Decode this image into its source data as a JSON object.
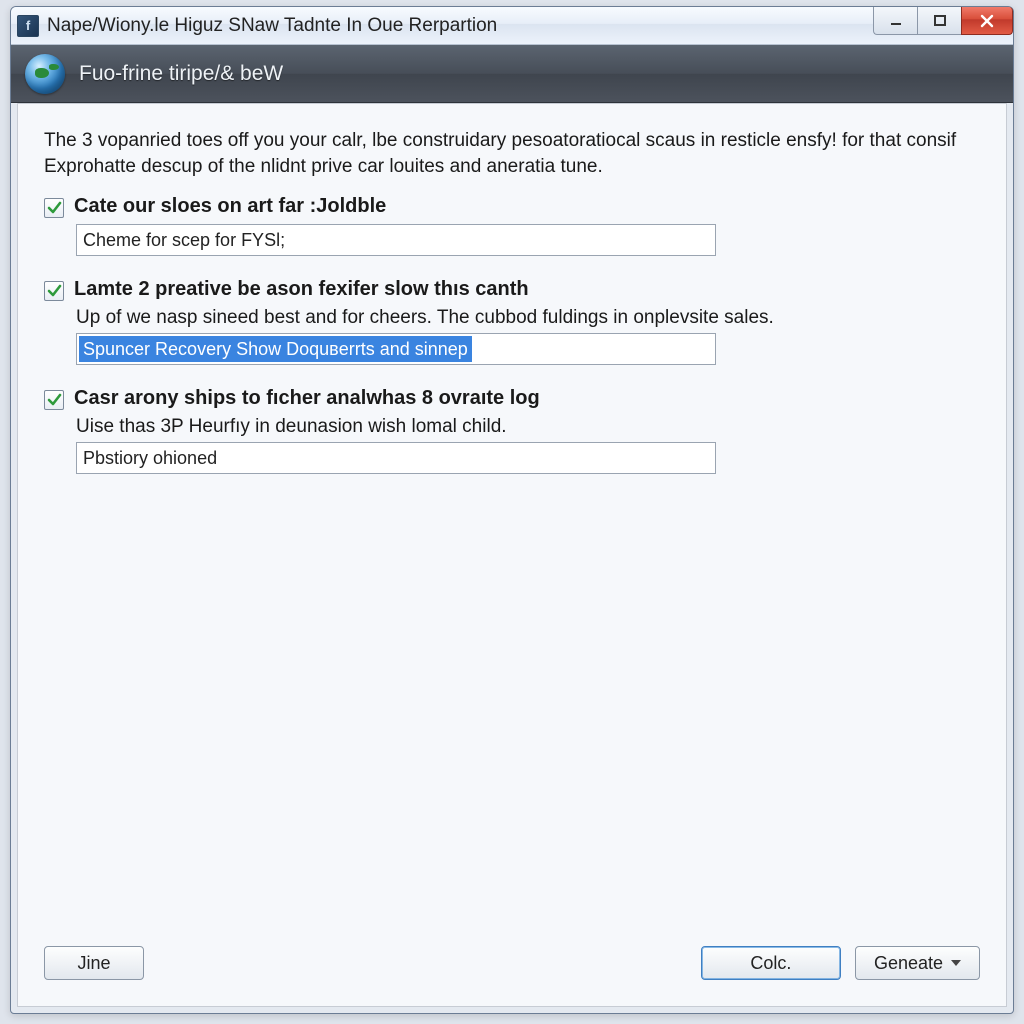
{
  "window": {
    "title": "Nape/Wiony.le Higuz SNaw Tadnte In Oue Rerpartion",
    "app_icon_letter": "f"
  },
  "banner": {
    "title": "Fuo-frine tiripe/& beW"
  },
  "intro": "The 3 vopanried toes off you your calr, lbe construidary pesoatoratiocal scaus in resticle ensfy! for that consif Exprohatte descup of the nlidnt prive car louites and aneratia tune.",
  "options": [
    {
      "checked": true,
      "title": "Cate our sloes on art far :Joldble",
      "desc": "",
      "input": "Cheme for scep for FYSl;"
    },
    {
      "checked": true,
      "title": "Lamte 2 preative be ason fexifer slow thıs canth",
      "desc": "Up of we nasp sineed best and for cheers. The cubbod fuldings in onplevsite sales.",
      "input": "Spuncer Recovery Show Doquвerrts and sinnep",
      "selected": true
    },
    {
      "checked": true,
      "title": "Casr arony ships to fıcher analwhas 8 ovraıte log",
      "desc": "Uise thas 3P Heurfıy in deunasion wish lomal child.",
      "input": "Pbstiory ohioned"
    }
  ],
  "footer": {
    "left_button": "Jine",
    "primary_button": "Colc.",
    "right_button": "Geneate"
  }
}
